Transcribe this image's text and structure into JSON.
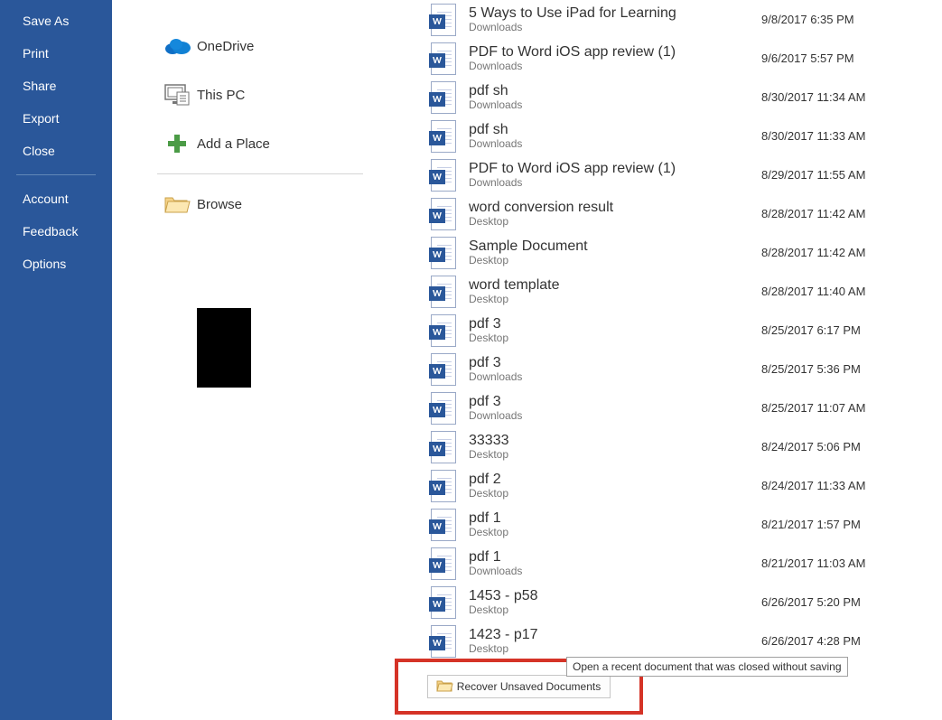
{
  "sidebar": {
    "items": [
      {
        "label": "Save As"
      },
      {
        "label": "Print"
      },
      {
        "label": "Share"
      },
      {
        "label": "Export"
      },
      {
        "label": "Close"
      }
    ],
    "lower": [
      {
        "label": "Account"
      },
      {
        "label": "Feedback"
      },
      {
        "label": "Options"
      }
    ]
  },
  "locations": {
    "items": [
      {
        "label": "OneDrive"
      },
      {
        "label": "This PC"
      },
      {
        "label": "Add a Place"
      },
      {
        "label": "Browse"
      }
    ]
  },
  "files": {
    "items": [
      {
        "name": "5 Ways to Use iPad for Learning",
        "loc": "Downloads",
        "date": "9/8/2017 6:35 PM"
      },
      {
        "name": "PDF to Word iOS app review (1)",
        "loc": "Downloads",
        "date": "9/6/2017 5:57 PM"
      },
      {
        "name": "pdf sh",
        "loc": "Downloads",
        "date": "8/30/2017 11:34 AM"
      },
      {
        "name": "pdf sh",
        "loc": "Downloads",
        "date": "8/30/2017 11:33 AM"
      },
      {
        "name": "PDF to Word iOS app review (1)",
        "loc": "Downloads",
        "date": "8/29/2017 11:55 AM"
      },
      {
        "name": "word conversion result",
        "loc": "Desktop",
        "date": "8/28/2017 11:42 AM"
      },
      {
        "name": "Sample Document",
        "loc": "Desktop",
        "date": "8/28/2017 11:42 AM"
      },
      {
        "name": "word template",
        "loc": "Desktop",
        "date": "8/28/2017 11:40 AM"
      },
      {
        "name": "pdf 3",
        "loc": "Desktop",
        "date": "8/25/2017 6:17 PM"
      },
      {
        "name": "pdf 3",
        "loc": "Downloads",
        "date": "8/25/2017 5:36 PM"
      },
      {
        "name": "pdf 3",
        "loc": "Downloads",
        "date": "8/25/2017 11:07 AM"
      },
      {
        "name": "33333",
        "loc": "Desktop",
        "date": "8/24/2017 5:06 PM"
      },
      {
        "name": "pdf 2",
        "loc": "Desktop",
        "date": "8/24/2017 11:33 AM"
      },
      {
        "name": "pdf 1",
        "loc": "Desktop",
        "date": "8/21/2017 1:57 PM"
      },
      {
        "name": "pdf 1",
        "loc": "Downloads",
        "date": "8/21/2017 11:03 AM"
      },
      {
        "name": "1453 - p58",
        "loc": "Desktop",
        "date": "6/26/2017 5:20 PM"
      },
      {
        "name": "1423 - p17",
        "loc": "Desktop",
        "date": "6/26/2017 4:28 PM"
      }
    ]
  },
  "recover": {
    "label": "Recover Unsaved Documents",
    "tooltip": "Open a recent document that was closed without saving"
  }
}
